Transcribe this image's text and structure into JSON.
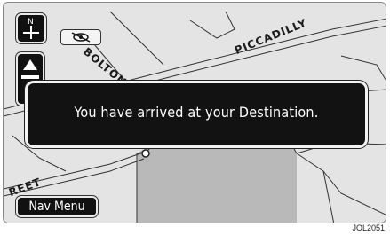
{
  "map": {
    "road_labels": {
      "bolton": "BOLTON ST",
      "piccadilly": "PICCADILLY",
      "street_left": "REET"
    },
    "colors": {
      "background": "#e4e4e4",
      "park_fill": "#b9b9b9",
      "road_line": "#333333"
    }
  },
  "controls": {
    "north_button_icon": "north-up-compass-icon",
    "heading_button_icon": "heading-up-arrow-icon",
    "audio_icon": "voice-muted-icon",
    "nav_menu_label": "Nav Menu"
  },
  "dialog": {
    "message": "You have arrived at your Destination."
  },
  "caption": "JOL2051"
}
